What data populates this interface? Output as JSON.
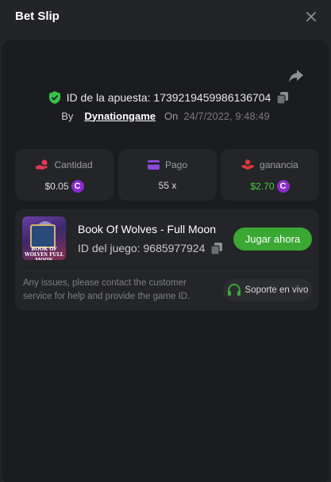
{
  "header": {
    "title": "Bet Slip"
  },
  "bet": {
    "id_label": "ID de la apuesta:",
    "id_value": "1739219459986136704",
    "by_label": "By",
    "username": "Dynationgame",
    "on_label": "On",
    "date": "24/7/2022, 9:48:49"
  },
  "stats": [
    {
      "label": "Cantidad",
      "value": "$0.05",
      "coin": true,
      "icon": "hand-coin-icon",
      "color": "#e2365a"
    },
    {
      "label": "Pago",
      "value": "55 x",
      "coin": false,
      "icon": "card-icon",
      "color": "#8a4ad8"
    },
    {
      "label": "ganancia",
      "value": "$2.70",
      "coin": true,
      "icon": "hand-receive-icon",
      "color": "#e23a3a",
      "value_color": "#44d13a"
    }
  ],
  "coin_symbol": "C",
  "game": {
    "name": "Book Of Wolves - Full Moon",
    "id_label": "ID del juego:",
    "id_value": "9685977924",
    "thumb_caption": "BOOK OF WOLVES FULL MOON",
    "play_label": "Jugar ahora",
    "issues_text": "Any issues, please contact the customer service for help and provide the game ID.",
    "support_label": "Soporte en vivo"
  },
  "colors": {
    "background": "#232427",
    "panel": "#1b1c1f",
    "card": "#242528",
    "accent_green": "#3aa832",
    "coin_purple": "#8a2cc9",
    "verified_green": "#35c24a"
  }
}
